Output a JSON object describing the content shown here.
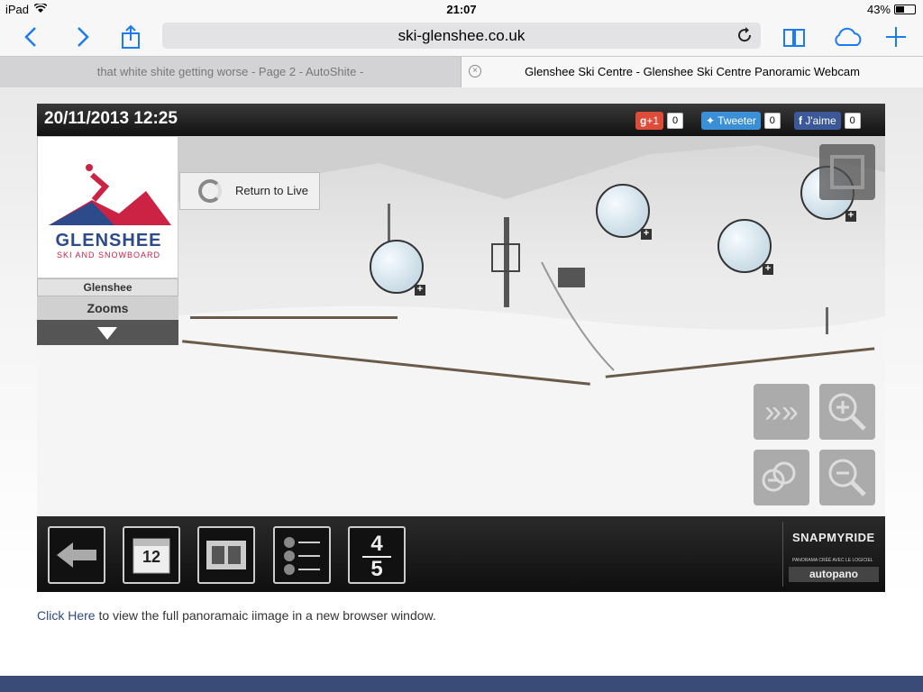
{
  "status": {
    "device": "iPad",
    "time": "21:07",
    "battery": "43%",
    "battery_fraction": 0.43
  },
  "browser": {
    "url": "ski-glenshee.co.uk",
    "tabs": [
      {
        "label": "that white shite getting worse - Page 2 - AutoShite -",
        "active": false
      },
      {
        "label": "Glenshee Ski Centre - Glenshee Ski Centre Panoramic Webcam",
        "active": true
      }
    ],
    "icons": {
      "back": "chevron-left-icon",
      "forward": "chevron-right-icon",
      "share": "share-icon",
      "reload": "reload-icon",
      "bookmarks": "book-icon",
      "cloud": "icloud-icon",
      "add": "plus-icon",
      "close": "close-icon"
    }
  },
  "viewer": {
    "datestamp": "20/11/2013 12:25",
    "social": {
      "gplus": {
        "label": "+1",
        "count": "0"
      },
      "twitter": {
        "label": "Tweeter",
        "count": "0"
      },
      "facebook": {
        "label": "J'aime",
        "count": "0"
      }
    },
    "logo": {
      "name": "GLENSHEE",
      "tagline": "SKI AND SNOWBOARD"
    },
    "location_label": "Glenshee",
    "zooms_label": "Zooms",
    "return_live": "Return to Live",
    "calendar_day": "12",
    "speed": {
      "top": "4",
      "bottom": "5"
    },
    "brand": {
      "name": "SNAPMYRIDE",
      "note": "PANORAMA CRÉÉ AVEC LE LOGICIEL",
      "product": "autopano"
    },
    "colors": {
      "gplus": "#dd4b39",
      "twitter": "#3a8fd6",
      "facebook": "#3b5998",
      "logo_blue": "#2d4a8a",
      "logo_red": "#cc2244"
    }
  },
  "caption": {
    "link": "Click Here",
    "text": " to view the full panoramaic iimage in a new browser window."
  }
}
